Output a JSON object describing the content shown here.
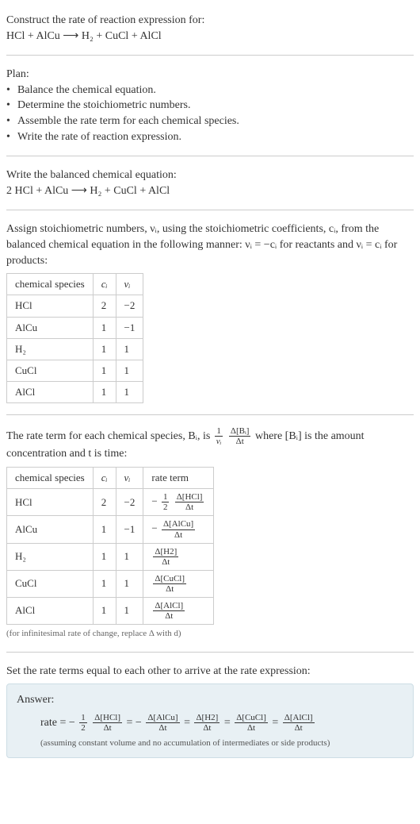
{
  "problem": {
    "title": "Construct the rate of reaction expression for:",
    "equation_unbalanced": "HCl + AlCu ⟶ H₂ + CuCl + AlCl"
  },
  "plan": {
    "heading": "Plan:",
    "items": [
      "Balance the chemical equation.",
      "Determine the stoichiometric numbers.",
      "Assemble the rate term for each chemical species.",
      "Write the rate of reaction expression."
    ]
  },
  "balanced": {
    "heading": "Write the balanced chemical equation:",
    "equation": "2 HCl + AlCu ⟶ H₂ + CuCl + AlCl"
  },
  "stoich": {
    "intro_1": "Assign stoichiometric numbers, νᵢ, using the stoichiometric coefficients, cᵢ, from the balanced chemical equation in the following manner: νᵢ = −cᵢ for reactants and νᵢ = cᵢ for products:",
    "headers": [
      "chemical species",
      "cᵢ",
      "νᵢ"
    ],
    "rows": [
      {
        "species": "HCl",
        "c": "2",
        "v": "−2"
      },
      {
        "species": "AlCu",
        "c": "1",
        "v": "−1"
      },
      {
        "species": "H₂",
        "c": "1",
        "v": "1"
      },
      {
        "species": "CuCl",
        "c": "1",
        "v": "1"
      },
      {
        "species": "AlCl",
        "c": "1",
        "v": "1"
      }
    ]
  },
  "rateterm": {
    "intro_prefix": "The rate term for each chemical species, Bᵢ, is ",
    "intro_suffix": " where [Bᵢ] is the amount concentration and t is time:",
    "frac_outer_num": "1",
    "frac_outer_den": "νᵢ",
    "frac_inner_num": "Δ[Bᵢ]",
    "frac_inner_den": "Δt",
    "headers": [
      "chemical species",
      "cᵢ",
      "νᵢ",
      "rate term"
    ],
    "rows": [
      {
        "species": "HCl",
        "c": "2",
        "v": "−2",
        "rt_prefix": "−",
        "rt_coef_num": "1",
        "rt_coef_den": "2",
        "rt_num": "Δ[HCl]",
        "rt_den": "Δt"
      },
      {
        "species": "AlCu",
        "c": "1",
        "v": "−1",
        "rt_prefix": "−",
        "rt_coef_num": "",
        "rt_coef_den": "",
        "rt_num": "Δ[AlCu]",
        "rt_den": "Δt"
      },
      {
        "species": "H₂",
        "c": "1",
        "v": "1",
        "rt_prefix": "",
        "rt_coef_num": "",
        "rt_coef_den": "",
        "rt_num": "Δ[H2]",
        "rt_den": "Δt"
      },
      {
        "species": "CuCl",
        "c": "1",
        "v": "1",
        "rt_prefix": "",
        "rt_coef_num": "",
        "rt_coef_den": "",
        "rt_num": "Δ[CuCl]",
        "rt_den": "Δt"
      },
      {
        "species": "AlCl",
        "c": "1",
        "v": "1",
        "rt_prefix": "",
        "rt_coef_num": "",
        "rt_coef_den": "",
        "rt_num": "Δ[AlCl]",
        "rt_den": "Δt"
      }
    ],
    "note": "(for infinitesimal rate of change, replace Δ with d)"
  },
  "final": {
    "heading": "Set the rate terms equal to each other to arrive at the rate expression:",
    "answer_label": "Answer:",
    "rate_prefix": "rate = −",
    "terms": [
      {
        "prefix": "−",
        "coef_num": "1",
        "coef_den": "2",
        "num": "Δ[HCl]",
        "den": "Δt"
      },
      {
        "prefix": "= −",
        "coef_num": "",
        "coef_den": "",
        "num": "Δ[AlCu]",
        "den": "Δt"
      },
      {
        "prefix": "=",
        "coef_num": "",
        "coef_den": "",
        "num": "Δ[H2]",
        "den": "Δt"
      },
      {
        "prefix": "=",
        "coef_num": "",
        "coef_den": "",
        "num": "Δ[CuCl]",
        "den": "Δt"
      },
      {
        "prefix": "=",
        "coef_num": "",
        "coef_den": "",
        "num": "Δ[AlCl]",
        "den": "Δt"
      }
    ],
    "assumption": "(assuming constant volume and no accumulation of intermediates or side products)"
  }
}
